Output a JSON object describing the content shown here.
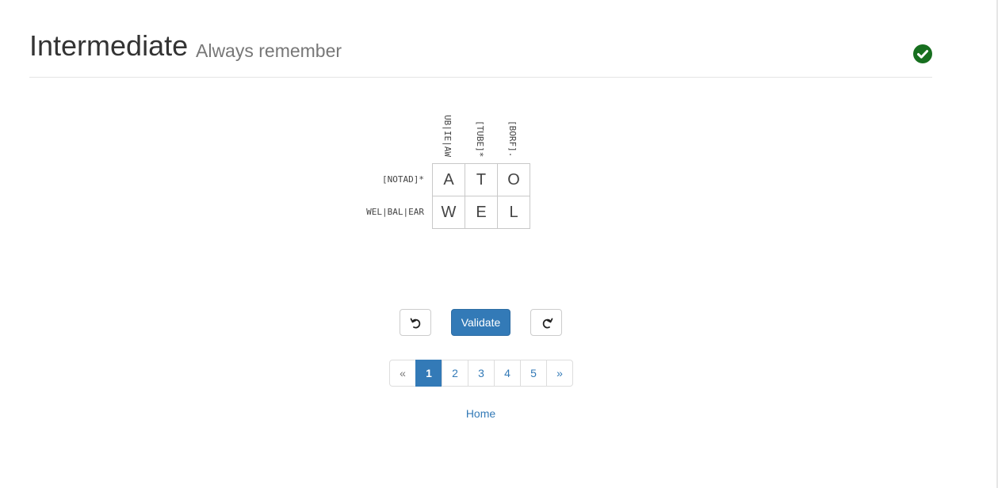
{
  "header": {
    "title": "Intermediate",
    "subtitle": "Always remember",
    "status_icon": "check-circle-icon",
    "status_color": "#176f1f"
  },
  "puzzle": {
    "column_clues": [
      "UB|IE|AW",
      "[TUBE]*",
      "[BORF]."
    ],
    "row_clues": [
      "[NOTAD]*",
      "WEL|BAL|EAR"
    ],
    "grid": [
      [
        "A",
        "T",
        "O"
      ],
      [
        "W",
        "E",
        "L"
      ]
    ]
  },
  "controls": {
    "undo_icon": "undo-icon",
    "validate_label": "Validate",
    "redo_icon": "redo-icon"
  },
  "pagination": {
    "prev_label": "«",
    "pages": [
      "1",
      "2",
      "3",
      "4",
      "5"
    ],
    "active_page": "1",
    "next_label": "»"
  },
  "footer": {
    "home_label": "Home"
  },
  "colors": {
    "accent": "#337ab7",
    "success": "#176f1f"
  }
}
